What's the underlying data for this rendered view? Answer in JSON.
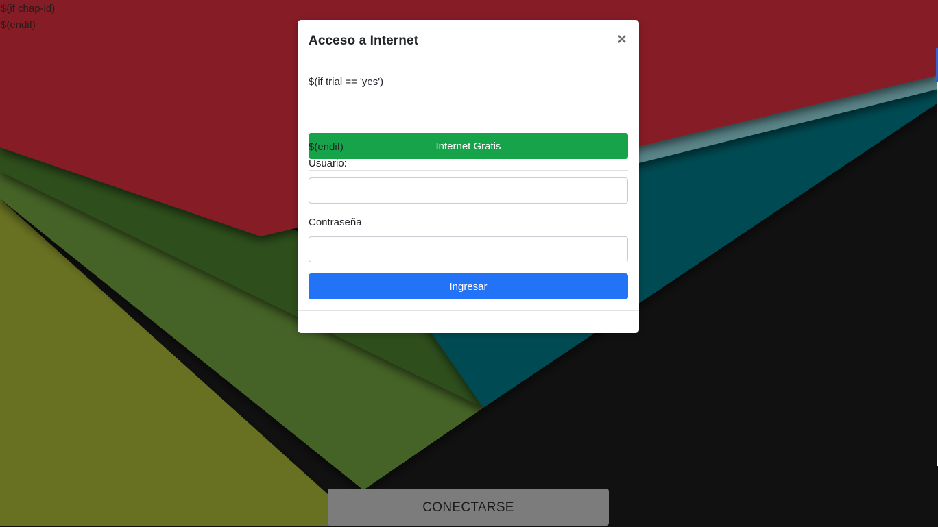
{
  "page": {
    "line1": "$(if chap-id)",
    "line2": "$(endif)"
  },
  "modal": {
    "title": "Acceso a Internet",
    "close_symbol": "×",
    "trial_text": "$(if trial == 'yes')",
    "trial_button": "Internet Gratis",
    "endif_text": "$(endif)",
    "username_label": "Usuario:",
    "username_value": "",
    "password_label": "Contraseña",
    "password_value": "",
    "submit_button": "Ingresar"
  },
  "connect_button": "CONECTARSE",
  "colors": {
    "crimson": "#861f28",
    "teal": "#014b52",
    "slate": "#5a8589",
    "dark_green": "#2f4f1e",
    "mid_green": "#456328",
    "olive": "#676f22",
    "black": "#111111",
    "green_button": "#16a349",
    "blue_button": "#2373f6"
  }
}
